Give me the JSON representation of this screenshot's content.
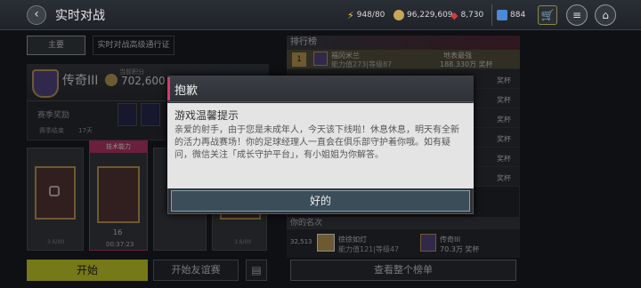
{
  "header": {
    "back_icon": "back-arrow-icon",
    "title": "实时对战",
    "energy": "948/80",
    "coins": "96,229,609",
    "gems": "8,730",
    "tickets": "884",
    "colors": {
      "energy": "#e5c84a",
      "coins": "#c9a55a",
      "gems": "#d43a3a",
      "tickets": "#4a8ad6"
    }
  },
  "tabs": [
    {
      "label": "主要"
    },
    {
      "label": "实时对战高级通行证"
    }
  ],
  "rank_card": {
    "name": "传奇III",
    "points_label": "当前积分",
    "points": "702,600",
    "season_reward_label": "赛季奖励",
    "season_end_label": "赛季结束",
    "season_end_value": "17天"
  },
  "cards": {
    "highlight_label": "技术能力",
    "card_count": "16",
    "card_timer": "00:37:23",
    "card_tag1": "3.6/00",
    "card_tag2": "3.6/00"
  },
  "actions": {
    "start_label": "开始",
    "friendly_label": "开始友谊赛",
    "clipboard_icon": "clipboard-icon"
  },
  "ranking": {
    "title": "排行榜",
    "top_entry": {
      "rank": "1",
      "name": "福冈米兰",
      "ability": "能力值273|等级87",
      "opponent": "地表最强",
      "points": "188.330万 奖杯"
    },
    "row_points": [
      "奖杯",
      "奖杯",
      "奖杯",
      "奖杯",
      "奖杯",
      "奖杯"
    ],
    "yours_title": "你的名次",
    "yours": {
      "rank": "32,513",
      "name": "徐徐如灯",
      "ability": "能力值121|等级47",
      "team": "传奇III",
      "points": "70.3万 奖杯"
    },
    "view_all_label": "查看整个榜单"
  },
  "modal": {
    "title": "抱歉",
    "heading": "游戏温馨提示",
    "body": "亲爱的射手，由于您是未成年人，今天该下线啦！休息休息，明天有全新的活力再战赛场！你的足球经理人一直会在俱乐部守护着你哦。如有疑问，微信关注「成长守护平台」，有小姐姐为你解答。",
    "ok_label": "好的"
  }
}
